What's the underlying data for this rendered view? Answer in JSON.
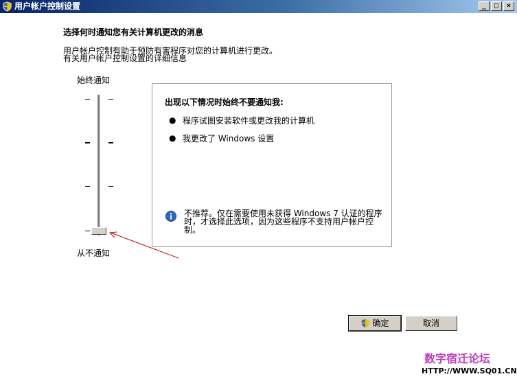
{
  "window": {
    "title": "用户帐户控制设置",
    "minimize": "_",
    "maximize": "□",
    "close": "×"
  },
  "heading": "选择何时通知您有关计算机更改的消息",
  "description": {
    "line1": "用户帐户控制有助于预防有害程序对您的计算机进行更改。",
    "line2": "有关用户帐户控制设置的详细信息"
  },
  "slider": {
    "top_label": "始终通知",
    "bottom_label": "从不通知",
    "levels": 4,
    "selected_level": 1
  },
  "panel": {
    "title": "出现以下情况时始终不要通知我:",
    "bullets": [
      "程序试图安装软件或更改我的计算机",
      "我更改了 Windows 设置"
    ],
    "bullet_glyph": "●",
    "note_line1": "不推荐。仅在需要使用未获得 Windows 7 认证的程序",
    "note_line2": "时，才选择此选项，因为这些程序不支持用户帐户控",
    "note_line3": "制。"
  },
  "buttons": {
    "ok": "确定",
    "cancel": "取消"
  },
  "watermark": {
    "line1": "数字宿迁论坛",
    "line2": "HTTP://WWW.SQ01.CN"
  },
  "colors": {
    "titlebar_start": "#0a246a",
    "titlebar_end": "#a6caf0",
    "annotation_arrow": "#c00000",
    "watermark": "#c03cc0"
  }
}
